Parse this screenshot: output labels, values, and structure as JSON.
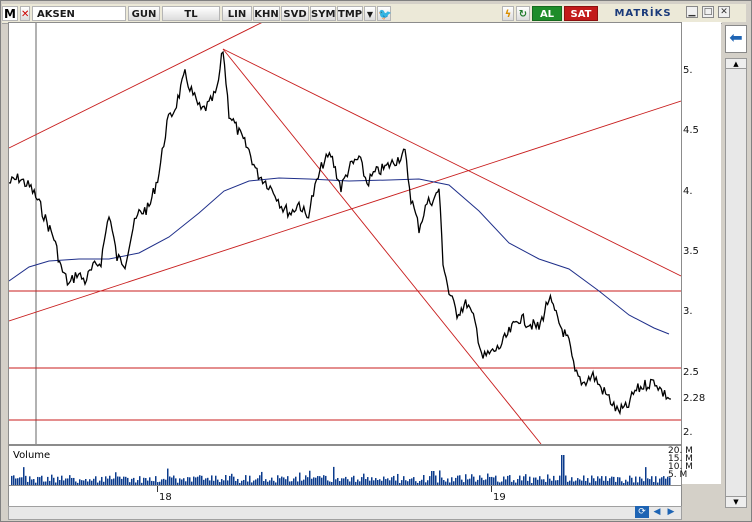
{
  "toolbar": {
    "logo": "M",
    "symbol": "AKSEN",
    "buttons": [
      "GUN",
      "TL",
      "LIN",
      "KHN",
      "SVD",
      "SYM",
      "TMP"
    ],
    "al_label": "AL",
    "sat_label": "SAT",
    "brand": "MATRİKS"
  },
  "chart": {
    "yticks": [
      {
        "label": "5.",
        "v": 5.0
      },
      {
        "label": "4.5",
        "v": 4.5
      },
      {
        "label": "4.",
        "v": 4.0
      },
      {
        "label": "3.5",
        "v": 3.5
      },
      {
        "label": "3.",
        "v": 3.0
      },
      {
        "label": "2.5",
        "v": 2.5
      },
      {
        "label": "2.28",
        "v": 2.28
      },
      {
        "label": "2.",
        "v": 2.0
      }
    ],
    "xticks": [
      "18",
      "19"
    ],
    "last_price": "2.28",
    "volume_label": "Volume",
    "volume_ticks": [
      "20. M",
      "15. M",
      "10. M",
      "5. M"
    ]
  },
  "colors": {
    "price": "#000000",
    "moving_average": "#1f2f8a",
    "trendline": "#c81e1e",
    "al": "#1e8c2a",
    "sat": "#c21a1a"
  },
  "icons": [
    "twitter-icon",
    "lightning-icon",
    "refresh-icon",
    "arrow-left-icon",
    "sync-icon"
  ]
}
